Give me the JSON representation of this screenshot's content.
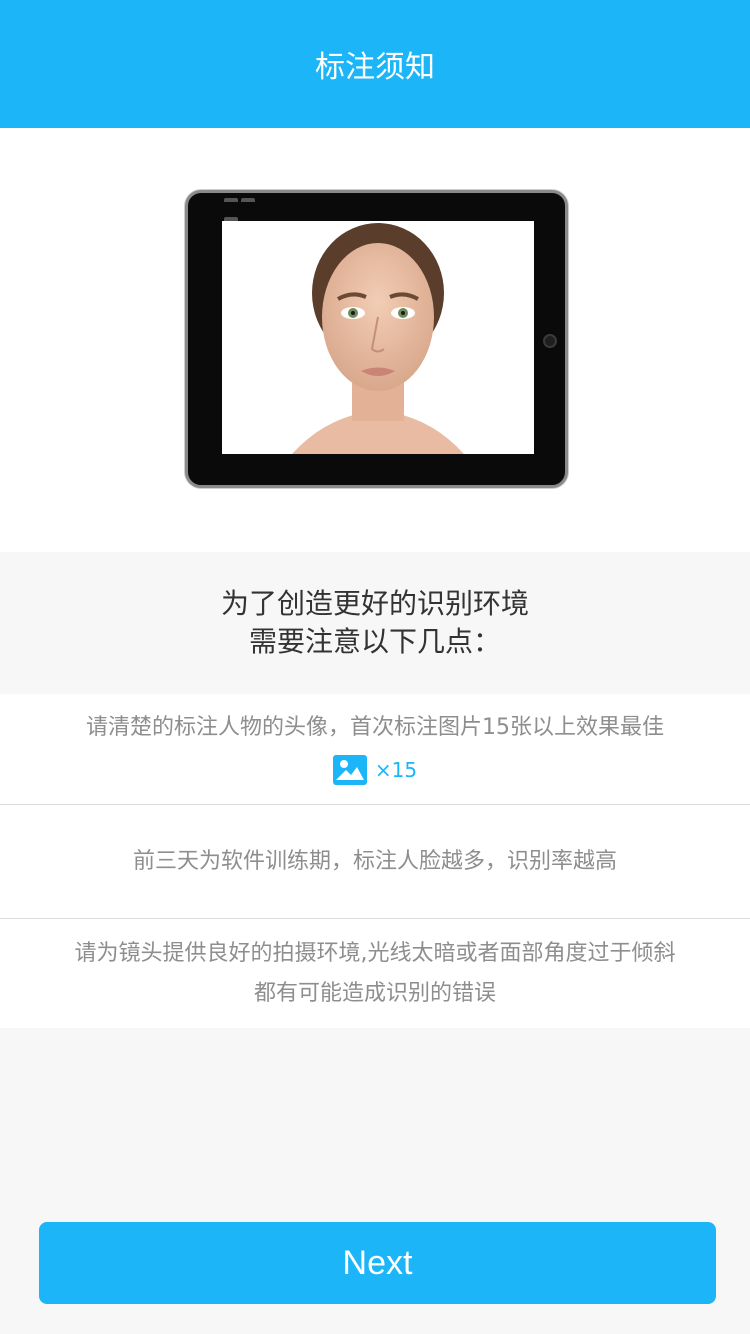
{
  "header": {
    "title": "标注须知"
  },
  "intro": {
    "line1": "为了创造更好的识别环境",
    "line2": "需要注意以下几点："
  },
  "tips": [
    {
      "line1": "请清楚的标注人物的头像，首次标注图片15张以上效果最佳",
      "count": "×15"
    },
    {
      "line1": "前三天为软件训练期，标注人脸越多，识别率越高"
    },
    {
      "line1": "请为镜头提供良好的拍摄环境,光线太暗或者面部角度过于倾斜",
      "line2": "都有可能造成识别的错误"
    }
  ],
  "actions": {
    "next_label": "Next"
  },
  "colors": {
    "accent": "#1bb5f8",
    "text_primary": "#333333",
    "text_secondary": "#8e8e8e"
  },
  "icons": {
    "photo": "image-icon"
  }
}
